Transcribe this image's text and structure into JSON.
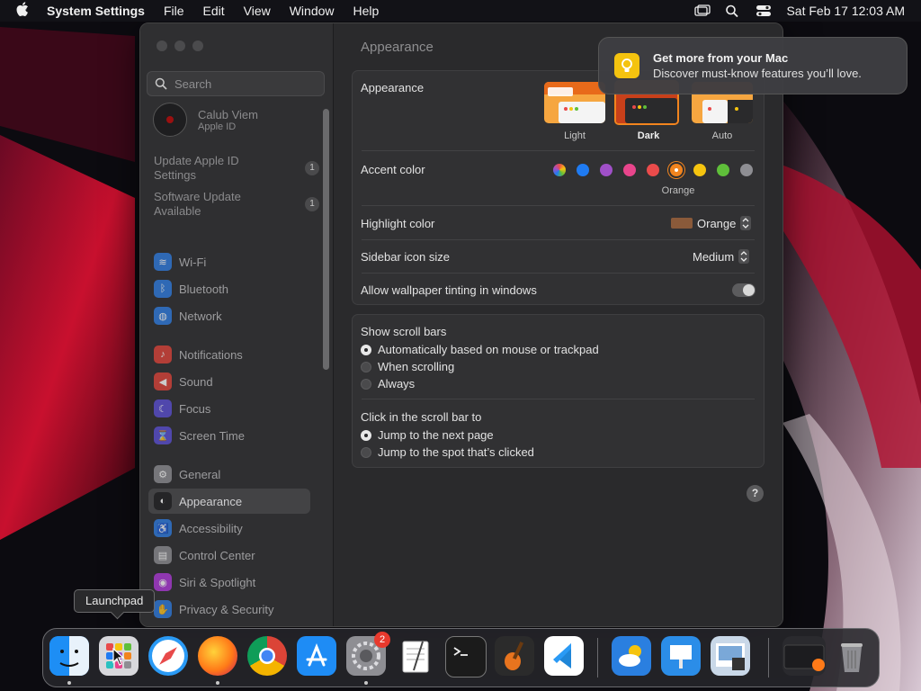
{
  "menubar": {
    "app_name": "System Settings",
    "menus": [
      "File",
      "Edit",
      "View",
      "Window",
      "Help"
    ],
    "clock": "Sat Feb 17  12:03 AM"
  },
  "sidebar": {
    "search_placeholder": "Search",
    "account": {
      "name": "Calub Viem",
      "subtitle": "Apple ID"
    },
    "updates": [
      {
        "label": "Update Apple ID Settings",
        "line1": "Update Apple ID",
        "line2": "Settings",
        "badge": "1"
      },
      {
        "label": "Software Update Available",
        "line1": "Software Update",
        "line2": "Available",
        "badge": "1"
      }
    ],
    "items": [
      {
        "label": "Wi-Fi",
        "icon": "wifi-icon",
        "color": "#2f7de1"
      },
      {
        "label": "Bluetooth",
        "icon": "bluetooth-icon",
        "color": "#2f7de1"
      },
      {
        "label": "Network",
        "icon": "globe-icon",
        "color": "#2f7de1"
      },
      {
        "label": "Notifications",
        "icon": "bell-icon",
        "color": "#e0443a"
      },
      {
        "label": "Sound",
        "icon": "speaker-icon",
        "color": "#e0443a"
      },
      {
        "label": "Focus",
        "icon": "moon-icon",
        "color": "#5b4fd6"
      },
      {
        "label": "Screen Time",
        "icon": "hourglass-icon",
        "color": "#5b4fd6"
      },
      {
        "label": "General",
        "icon": "gear-icon",
        "color": "#8e8e93"
      },
      {
        "label": "Appearance",
        "icon": "appearance-icon",
        "color": "#1c1c1e"
      },
      {
        "label": "Accessibility",
        "icon": "accessibility-icon",
        "color": "#2f7de1"
      },
      {
        "label": "Control Center",
        "icon": "control-center-icon",
        "color": "#8e8e93"
      },
      {
        "label": "Siri & Spotlight",
        "icon": "siri-icon",
        "color": "#b03adb"
      },
      {
        "label": "Privacy & Security",
        "icon": "hand-icon",
        "color": "#2f7de1"
      }
    ],
    "selected": "Appearance"
  },
  "content": {
    "title": "Appearance",
    "appearance": {
      "label": "Appearance",
      "options": [
        "Light",
        "Dark",
        "Auto"
      ],
      "selected": "Dark"
    },
    "accent": {
      "label": "Accent color",
      "colors": [
        "multicolor",
        "#1f7bf2",
        "#a050c8",
        "#e8458c",
        "#ea4b4b",
        "#f2841e",
        "#f5c40f",
        "#5fbf3a",
        "#8e8e93"
      ],
      "selected_name": "Orange"
    },
    "highlight": {
      "label": "Highlight color",
      "value": "Orange",
      "swatch": "#8a5a3a"
    },
    "sidebar_icon_size": {
      "label": "Sidebar icon size",
      "value": "Medium"
    },
    "wallpaper_tinting": {
      "label": "Allow wallpaper tinting in windows",
      "on": false
    },
    "scroll_bars": {
      "label": "Show scroll bars",
      "options": [
        "Automatically based on mouse or trackpad",
        "When scrolling",
        "Always"
      ],
      "selected": 0
    },
    "click_scroll": {
      "label": "Click in the scroll bar to",
      "options": [
        "Jump to the next page",
        "Jump to the spot that’s clicked"
      ],
      "selected": 0
    },
    "help": "?"
  },
  "notification": {
    "title": "Get more from your Mac",
    "body": "Discover must-know features you’ll love."
  },
  "tooltip": "Launchpad",
  "dock": {
    "apps": [
      {
        "name": "finder-icon",
        "color": "#1d8ef5",
        "running": true
      },
      {
        "name": "launchpad-icon",
        "color": "#d8d8dc",
        "running": false
      },
      {
        "name": "safari-icon",
        "color": "#2a9af5",
        "running": false
      },
      {
        "name": "firefox-icon",
        "color": "#ff7a18",
        "running": true
      },
      {
        "name": "chrome-icon",
        "color": "#e8e8e8",
        "running": false
      },
      {
        "name": "app-store-icon",
        "color": "#1e8cf5",
        "running": false
      },
      {
        "name": "system-settings-icon",
        "color": "#8e8e93",
        "running": true,
        "badge": "2"
      },
      {
        "name": "textedit-icon",
        "color": "#f2f2f2",
        "running": false
      },
      {
        "name": "terminal-icon",
        "color": "#1b1b1b",
        "running": false
      },
      {
        "name": "garageband-icon",
        "color": "#2b2b2b",
        "running": false
      },
      {
        "name": "vscode-icon",
        "color": "#ffffff",
        "running": false
      },
      {
        "name": "weather-icon",
        "color": "#2a7fe0",
        "running": false
      },
      {
        "name": "keynote-icon",
        "color": "#2b8de8",
        "running": false
      },
      {
        "name": "preview-icon",
        "color": "#c9d8e8",
        "running": false
      },
      {
        "name": "recent-window-icon",
        "color": "#2a2a2e",
        "running": false
      },
      {
        "name": "trash-icon",
        "color": "#9a9aa0",
        "running": false
      }
    ]
  }
}
